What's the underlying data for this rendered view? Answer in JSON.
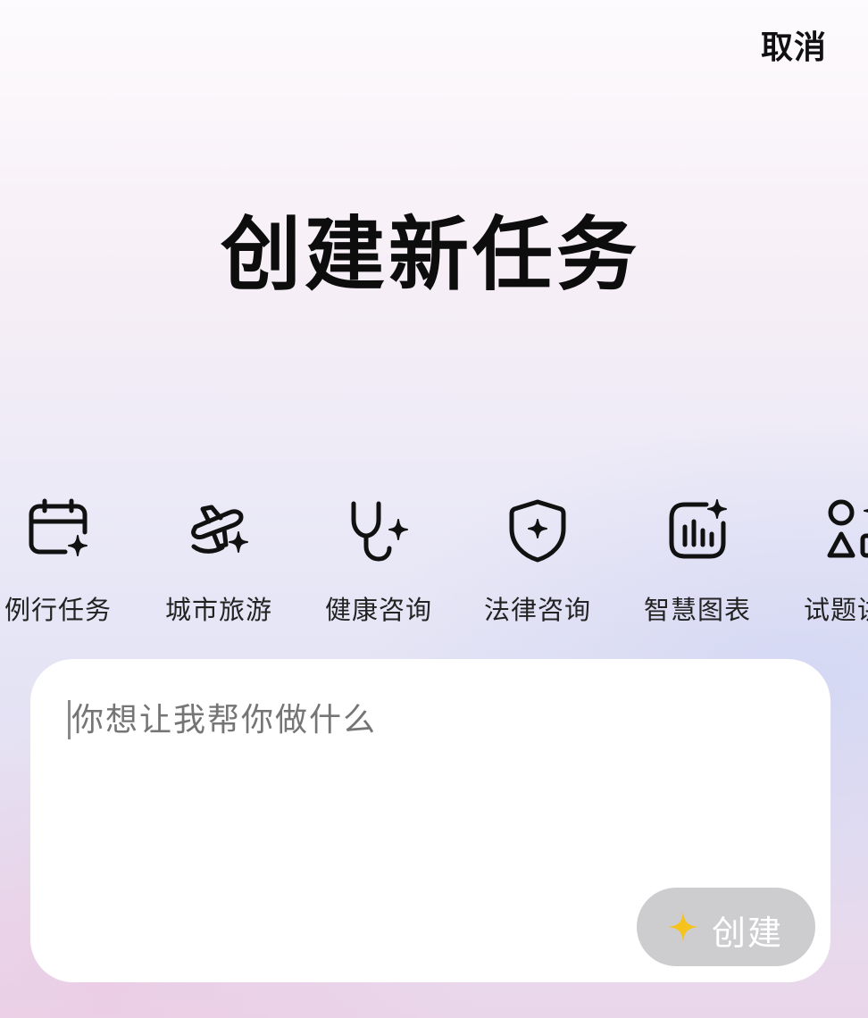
{
  "header": {
    "cancel_label": "取消"
  },
  "title": "创建新任务",
  "categories": [
    {
      "label": "例行任务",
      "icon": "calendar-sparkle-icon"
    },
    {
      "label": "城市旅游",
      "icon": "airplane-sparkle-icon"
    },
    {
      "label": "健康咨询",
      "icon": "stethoscope-sparkle-icon"
    },
    {
      "label": "法律咨询",
      "icon": "shield-sparkle-icon"
    },
    {
      "label": "智慧图表",
      "icon": "bar-chart-sparkle-icon"
    },
    {
      "label": "试题讲解",
      "icon": "shapes-icon"
    }
  ],
  "input": {
    "placeholder": "你想让我帮你做什么"
  },
  "create_button": {
    "label": "创建",
    "icon": "sparkle-icon",
    "accent_color": "#f6c21c"
  },
  "colors": {
    "icon_stroke": "#111111",
    "button_bg": "#cdcdd0"
  }
}
